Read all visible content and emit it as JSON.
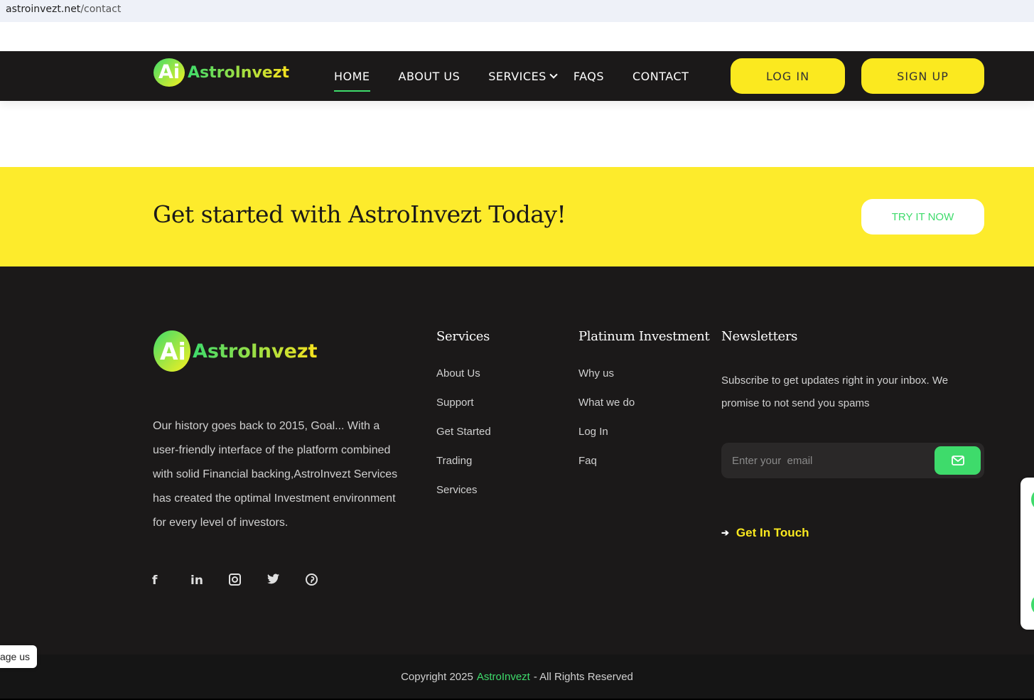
{
  "browser": {
    "url_host": "astroinvezt.net",
    "url_path": "/contact"
  },
  "brand": {
    "mark": "Ai",
    "name": "AstroInvezt"
  },
  "nav": {
    "items": [
      {
        "label": "HOME",
        "active": true
      },
      {
        "label": "ABOUT US"
      },
      {
        "label": "SERVICES",
        "dropdown": true
      },
      {
        "label": "FAQS"
      },
      {
        "label": "CONTACT"
      }
    ],
    "login": "LOG IN",
    "signup": "SIGN UP"
  },
  "cta": {
    "heading": "Get started with AstroInvezt Today!",
    "button": "TRY IT NOW"
  },
  "footer": {
    "about": "Our history goes back to 2015, Goal... With a user-friendly interface of the platform combined with solid Financial backing,AstroInvezt Services has created the optimal Investment environment for every level of investors.",
    "services": {
      "title": "Services",
      "items": [
        "About Us",
        "Support",
        "Get Started",
        "Trading",
        "Services"
      ]
    },
    "platinum": {
      "title": "Platinum Investment",
      "items": [
        "Why us",
        "What we do",
        "Log In",
        "Faq"
      ]
    },
    "newsletter": {
      "title": "Newsletters",
      "text": "Subscribe to get updates right in your inbox. We promise to not send you spams",
      "placeholder": "Enter your  email"
    },
    "get_in_touch": "Get In Touch",
    "socials": [
      "facebook-icon",
      "linkedin-icon",
      "instagram-icon",
      "twitter-icon",
      "pinterest-icon"
    ]
  },
  "copyright": {
    "prefix": "Copyright 2025",
    "brand": "AstroInvezt",
    "suffix": "- All Rights Reserved"
  },
  "manage_tab": "age us",
  "colors": {
    "accent_green": "#3edb6b",
    "accent_yellow": "#fbe91f",
    "dark": "#1b1919"
  }
}
